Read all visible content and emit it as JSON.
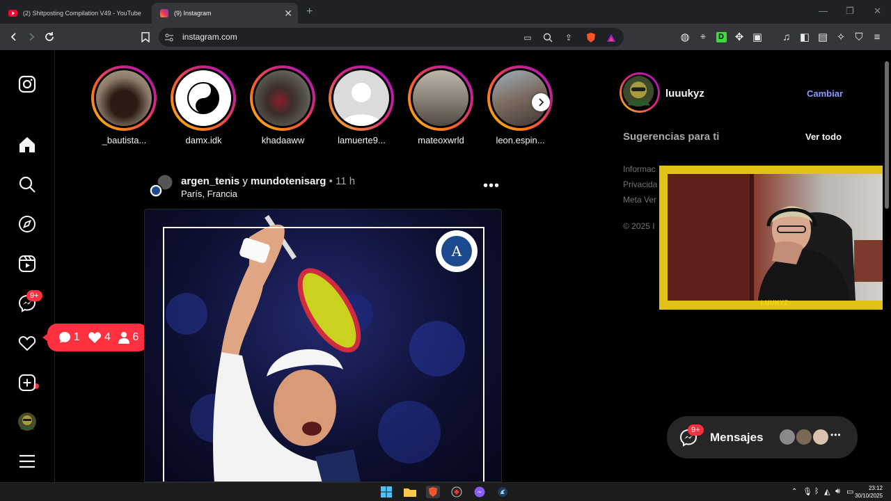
{
  "browser": {
    "tabs": [
      {
        "title": "(2) Shitposting Compilation V49 - YouTube"
      },
      {
        "title": "(9) Instagram"
      }
    ],
    "url": "instagram.com"
  },
  "nav": {
    "notifications_badge": "9+",
    "activity": {
      "comments": "1",
      "likes": "4",
      "follows": "6"
    }
  },
  "stories": [
    {
      "name": "_bautista...",
      "color": "#6d5a4a"
    },
    {
      "name": "damx.idk",
      "color": "#ffffff"
    },
    {
      "name": "khadaaww",
      "color": "#4a4a44"
    },
    {
      "name": "lamuerte9...",
      "color": "#dbdbdb"
    },
    {
      "name": "mateoxwrld",
      "color": "#8c8479"
    },
    {
      "name": "leon.espin...",
      "color": "#7b6a5f"
    }
  ],
  "post": {
    "author": "argen_tenis",
    "connector": "y",
    "coauthor": "mundotenisarg",
    "time": "11 h",
    "location": "París, Francia",
    "badge_letter": "A"
  },
  "sidebar": {
    "username": "luuukyz",
    "switch_label": "Cambiar",
    "suggestions_label": "Sugerencias para ti",
    "see_all_label": "Ver todo",
    "footer": [
      "Informac",
      "Privacida",
      "Meta Ver",
      "© 2025 I"
    ]
  },
  "webcam": {
    "tag": "LUUKYZ"
  },
  "messages": {
    "label": "Mensajes",
    "badge": "9+"
  },
  "taskbar": {
    "time": "23:12",
    "date": "30/10/2025"
  }
}
